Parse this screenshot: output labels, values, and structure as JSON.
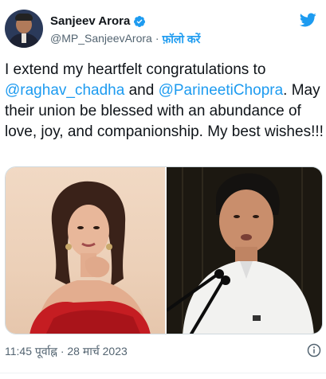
{
  "author": {
    "name": "Sanjeev Arora",
    "handle": "@MP_SanjeevArora",
    "separator": "·",
    "follow_label": "फ़ॉलो करें"
  },
  "tweet": {
    "line1": "I extend my heartfelt congratulations to",
    "mention1": "@raghav_chadha",
    "and": " and ",
    "mention2": "@ParineetiChopra",
    "rest": ". May their union be blessed with an abundance of love, joy, and companionship. My best wishes!!!"
  },
  "timestamp": "11:45 पूर्वाह्न · 28 मार्च 2023",
  "icons": {
    "verified": "verified-badge-icon",
    "brand": "twitter-bird-icon",
    "info": "info-icon"
  },
  "colors": {
    "accent": "#1d9bf0",
    "text": "#0f1419",
    "secondary": "#536471"
  }
}
